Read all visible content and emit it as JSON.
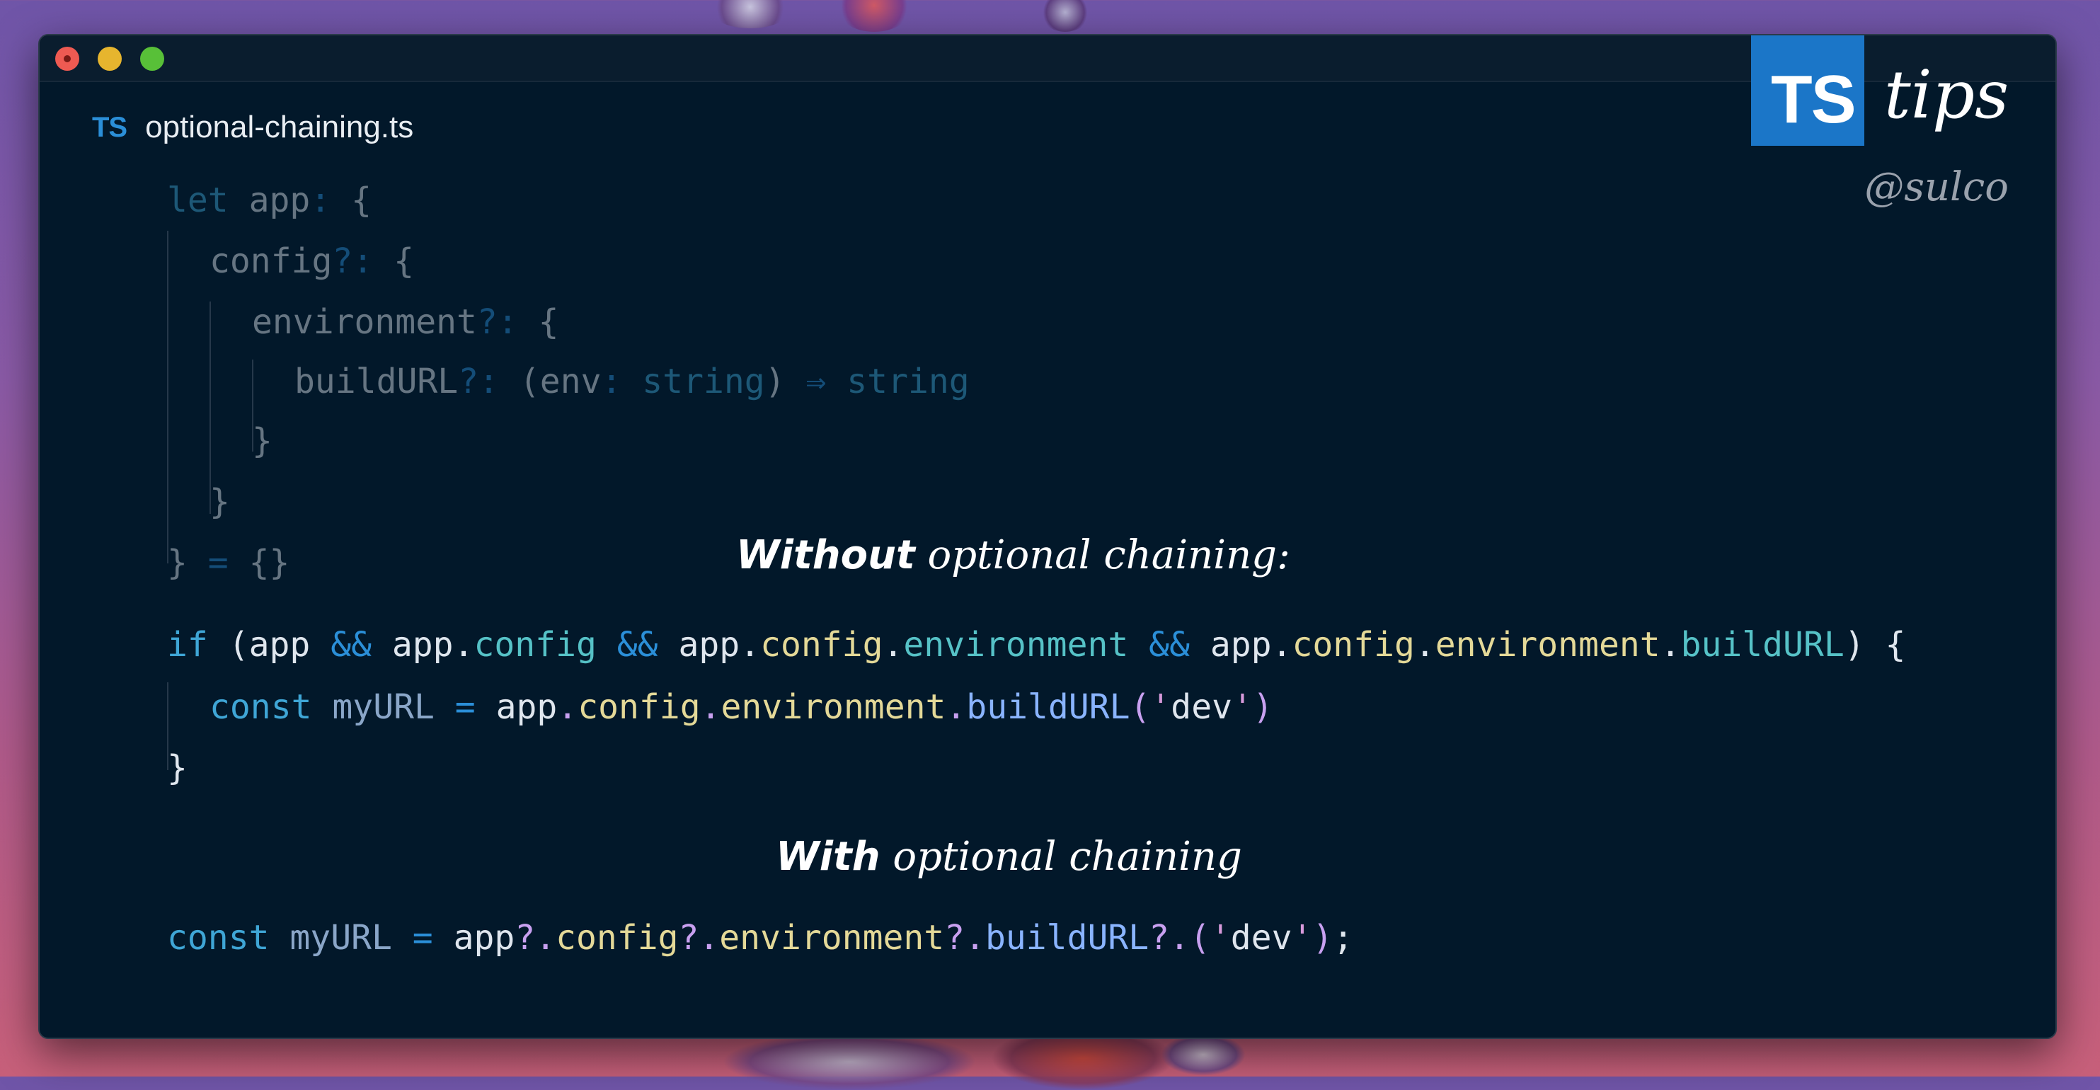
{
  "window": {
    "file_badge": "TS",
    "file_name": "optional-chaining.ts"
  },
  "logo": {
    "ts": "TS",
    "tips": "tips",
    "handle": "@sulco"
  },
  "headings": {
    "without_bold": "Without",
    "without_rest": " optional chaining:",
    "with_bold": "With",
    "with_rest": " optional chaining"
  },
  "code_type_block": [
    "let app: {",
    "config?: {",
    "environment?: {",
    "buildURL?: (env: string) ⇒ string",
    "}",
    "}",
    "} = {}"
  ],
  "code_without": {
    "line1": "if (app && app.config && app.config.environment && app.config.environment.buildURL) {",
    "line2": "const myURL = app.config.environment.buildURL('dev')",
    "line3": "}"
  },
  "code_with": "const myURL = app?.config?.environment?.buildURL?.('dev');",
  "colors": {
    "window_bg": "#02182a",
    "keyword": "#3fa6d6",
    "typescript_blue": "#1b76c8"
  }
}
